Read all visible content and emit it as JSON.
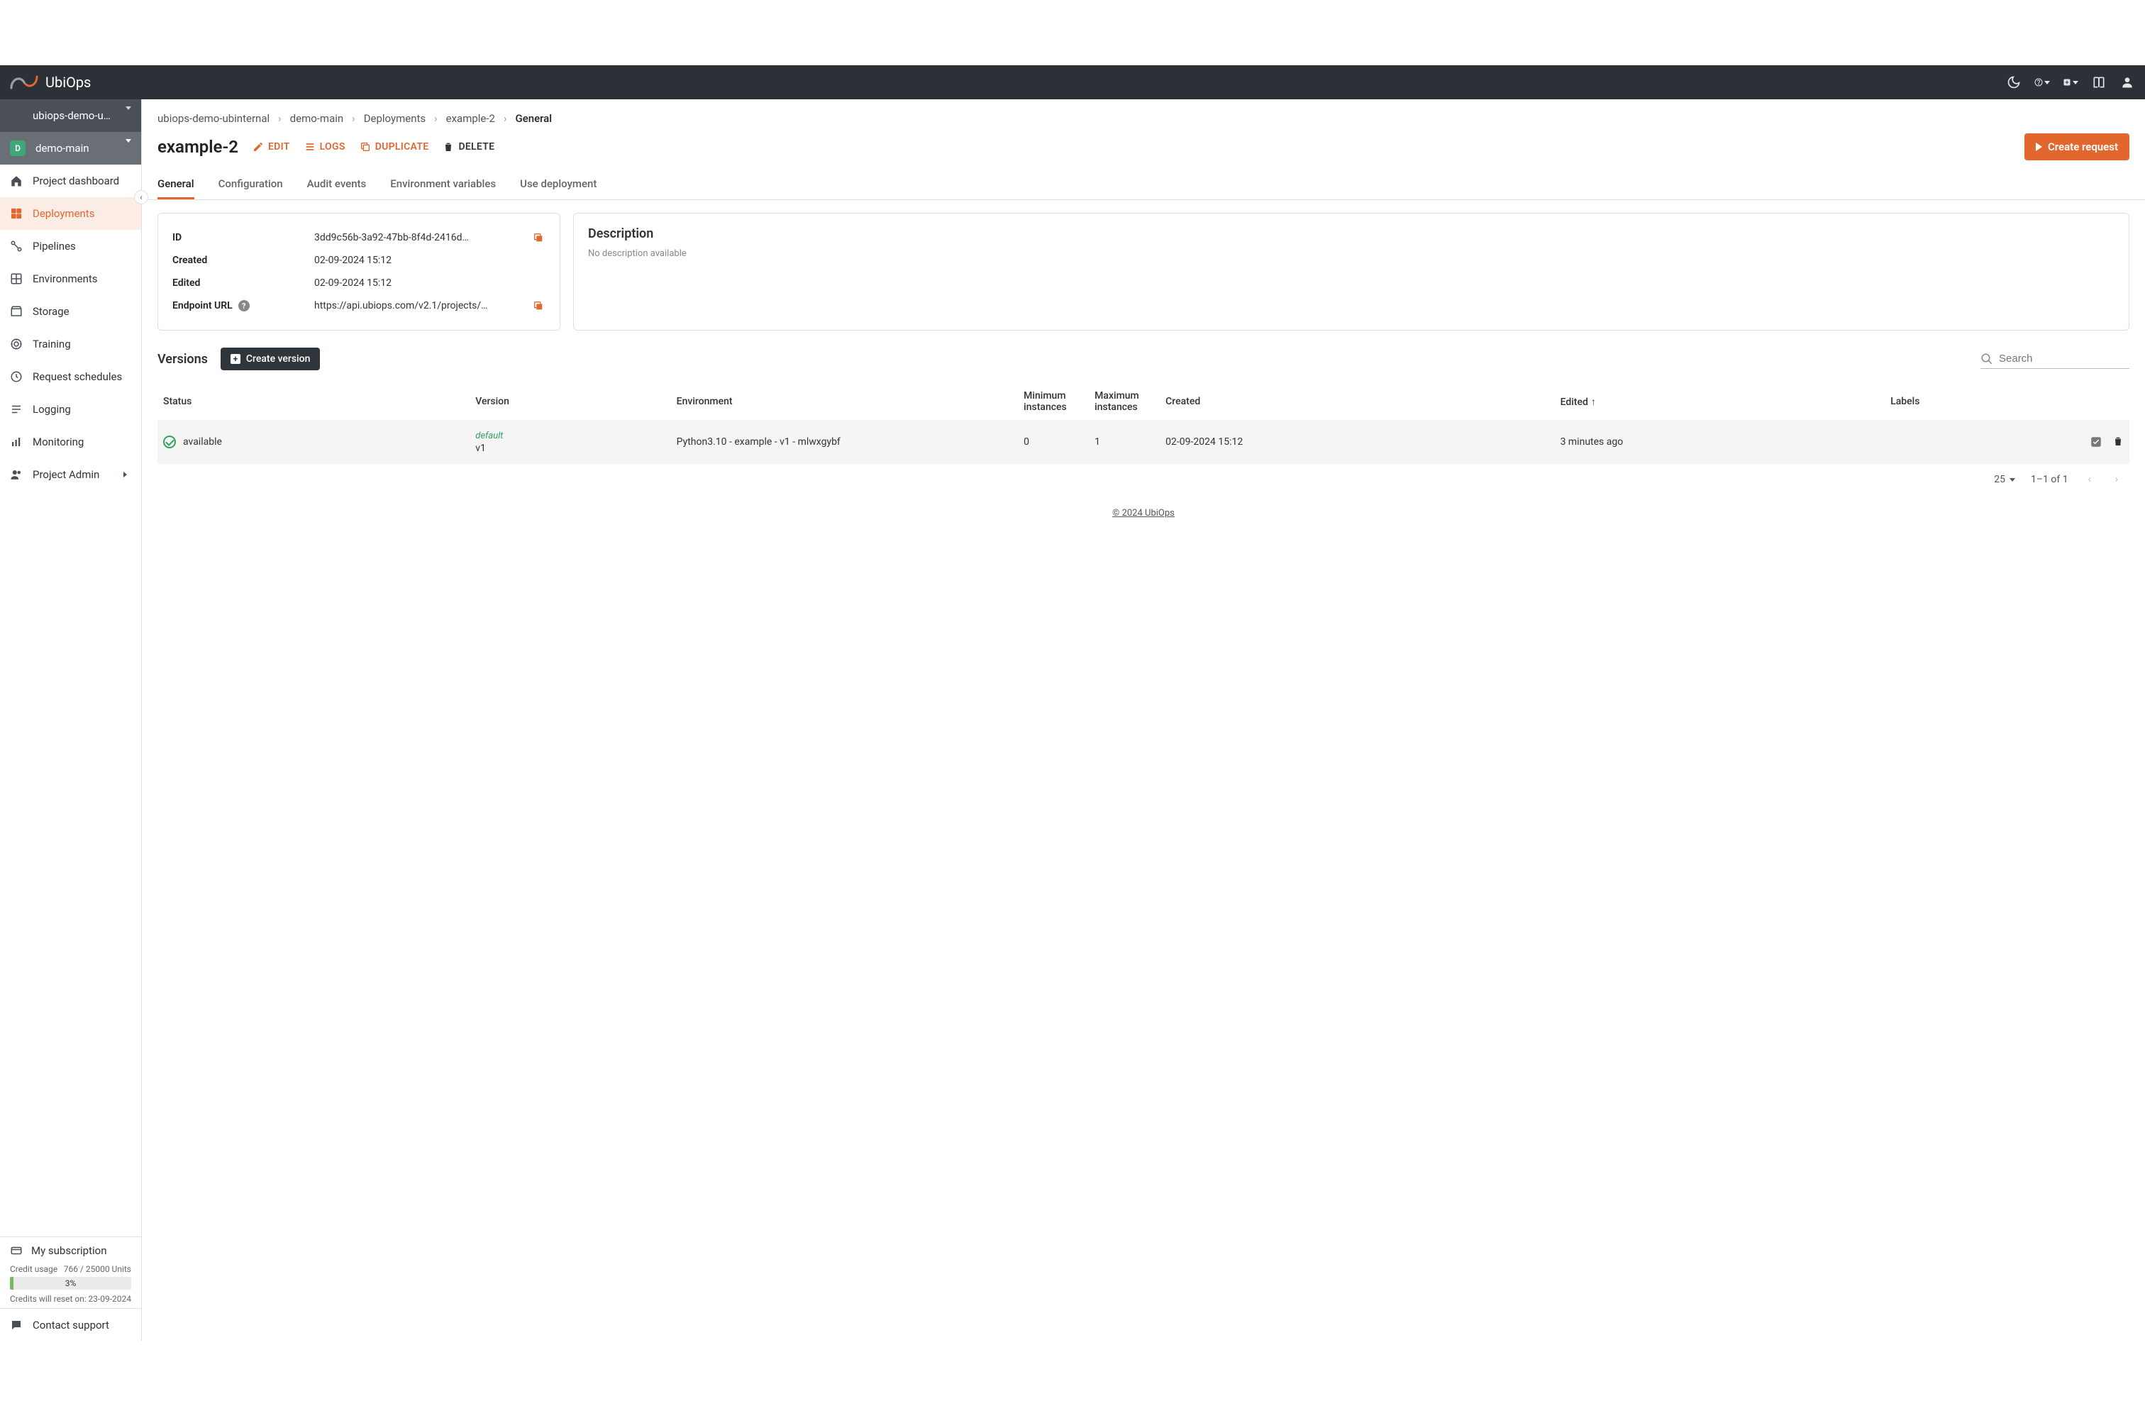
{
  "brand": "UbiOps",
  "org": {
    "name": "ubiops-demo-u…"
  },
  "project": {
    "initial": "D",
    "name": "demo-main"
  },
  "nav": {
    "dashboard": "Project dashboard",
    "deployments": "Deployments",
    "pipelines": "Pipelines",
    "environments": "Environments",
    "storage": "Storage",
    "training": "Training",
    "schedules": "Request schedules",
    "logging": "Logging",
    "monitoring": "Monitoring",
    "admin": "Project Admin"
  },
  "subscription": {
    "title": "My subscription",
    "credit_label": "Credit usage",
    "credit_value": "766 / 25000 Units",
    "percent": "3%",
    "reset_label": "Credits will reset on:",
    "reset_date": "23-09-2024"
  },
  "support": "Contact support",
  "breadcrumb": {
    "a": "ubiops-demo-ubinternal",
    "b": "demo-main",
    "c": "Deployments",
    "d": "example-2",
    "e": "General"
  },
  "page_title": "example-2",
  "actions": {
    "edit": "EDIT",
    "logs": "LOGS",
    "dup": "DUPLICATE",
    "del": "DELETE",
    "create_request": "Create request"
  },
  "tabs": {
    "general": "General",
    "config": "Configuration",
    "audit": "Audit events",
    "envvars": "Environment variables",
    "use": "Use deployment"
  },
  "details": {
    "id_label": "ID",
    "id_value": "3dd9c56b-3a92-47bb-8f4d-2416d…",
    "created_label": "Created",
    "created_value": "02-09-2024 15:12",
    "edited_label": "Edited",
    "edited_value": "02-09-2024 15:12",
    "endpoint_label": "Endpoint URL",
    "endpoint_value": "https://api.ubiops.com/v2.1/projects/…"
  },
  "description": {
    "title": "Description",
    "empty": "No description available"
  },
  "versions": {
    "title": "Versions",
    "create": "Create version",
    "search_placeholder": "Search",
    "columns": {
      "status": "Status",
      "version": "Version",
      "environment": "Environment",
      "min": "Minimum instances",
      "max": "Maximum instances",
      "created": "Created",
      "edited": "Edited",
      "labels": "Labels"
    },
    "row": {
      "status": "available",
      "default_tag": "default",
      "name": "v1",
      "environment": "Python3.10 - example - v1 - mlwxgybf",
      "min": "0",
      "max": "1",
      "created": "02-09-2024 15:12",
      "edited": "3 minutes ago"
    },
    "pager": {
      "per_page": "25",
      "range": "1–1 of 1"
    }
  },
  "footer": "© 2024 UbiOps"
}
